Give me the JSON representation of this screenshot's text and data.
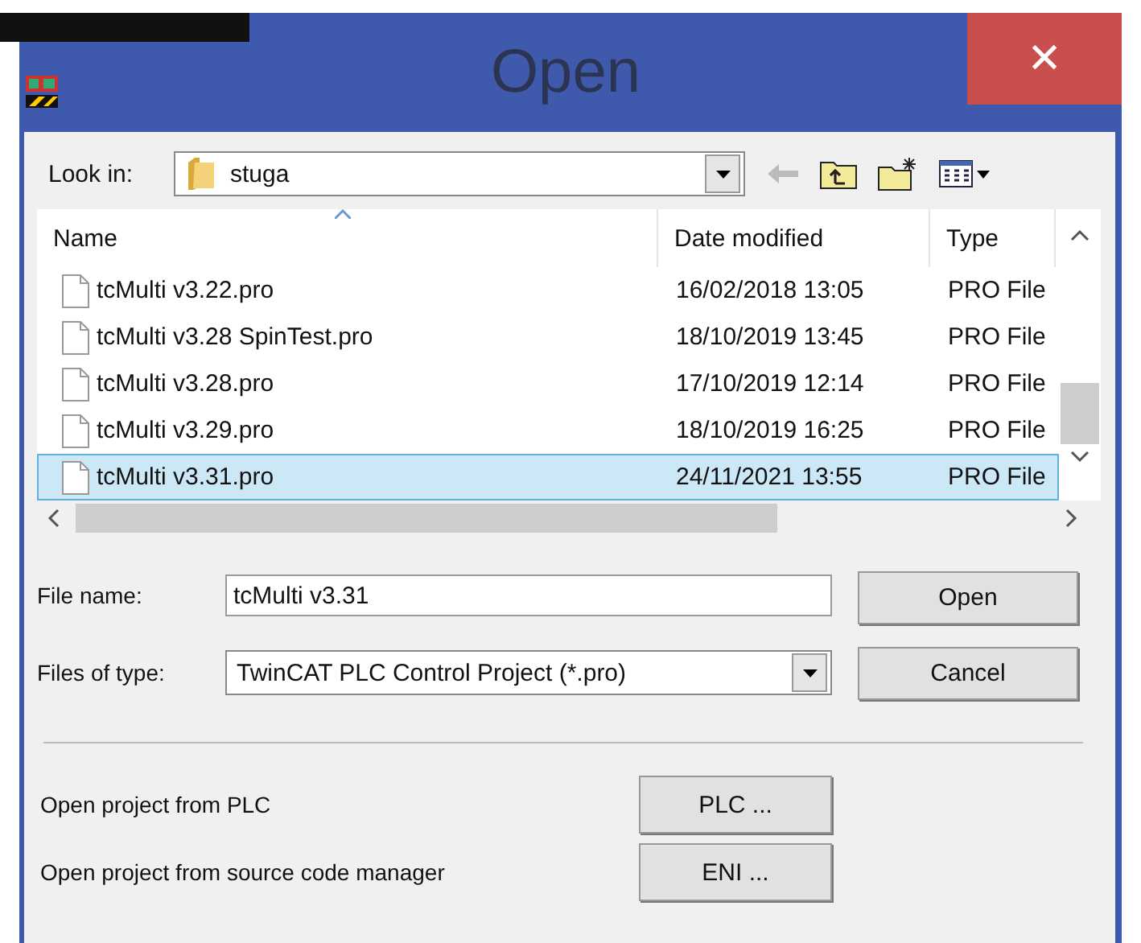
{
  "window": {
    "title": "Open",
    "close": "✕"
  },
  "look_in": {
    "label": "Look in:",
    "value": "stuga"
  },
  "file_list": {
    "columns": [
      "Name",
      "Date modified",
      "Type"
    ],
    "rows": [
      {
        "name": "tcMulti v3.22.pro",
        "date": "16/02/2018 13:05",
        "type": "PRO File",
        "selected": false
      },
      {
        "name": "tcMulti v3.28 SpinTest.pro",
        "date": "18/10/2019 13:45",
        "type": "PRO File",
        "selected": false
      },
      {
        "name": "tcMulti v3.28.pro",
        "date": "17/10/2019 12:14",
        "type": "PRO File",
        "selected": false
      },
      {
        "name": "tcMulti v3.29.pro",
        "date": "18/10/2019 16:25",
        "type": "PRO File",
        "selected": false
      },
      {
        "name": "tcMulti v3.31.pro",
        "date": "24/11/2021 13:55",
        "type": "PRO File",
        "selected": true
      }
    ]
  },
  "file_name": {
    "label": "File name:",
    "value": "tcMulti v3.31"
  },
  "file_type": {
    "label": "Files of type:",
    "value": "TwinCAT PLC Control Project (*.pro)"
  },
  "buttons": [
    "Open",
    "Cancel"
  ],
  "extra": [
    {
      "label": "Open project from PLC",
      "button": "PLC ..."
    },
    {
      "label": "Open project from source code manager",
      "button": "ENI ..."
    }
  ]
}
